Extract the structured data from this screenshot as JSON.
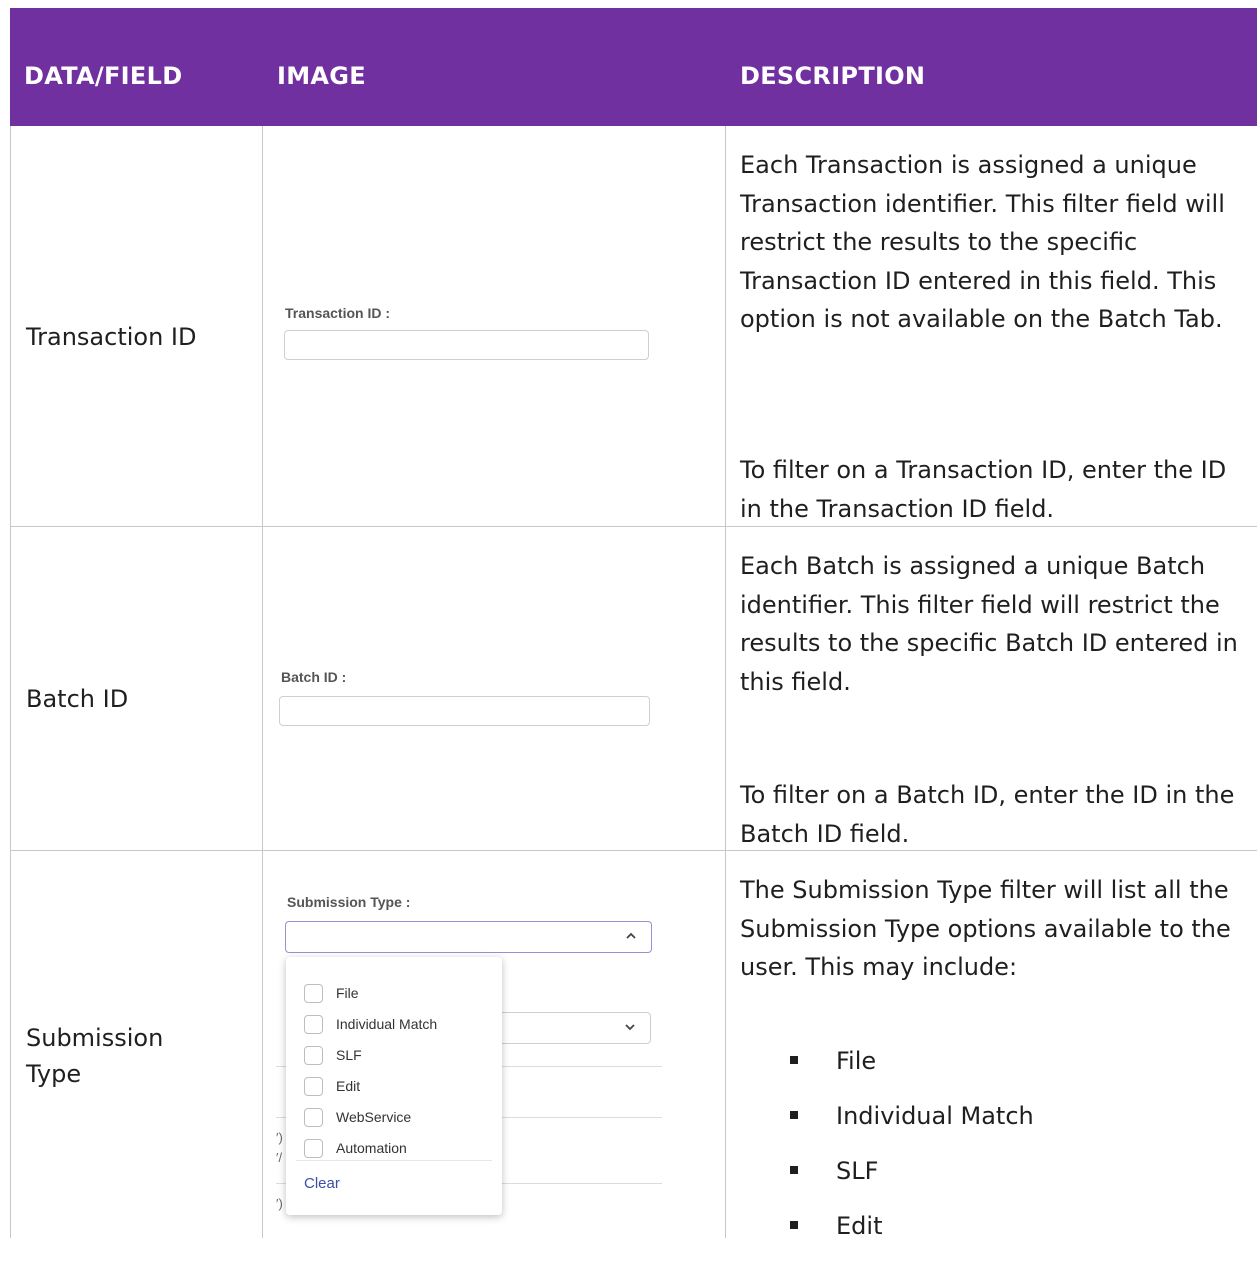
{
  "table": {
    "headers": [
      "DATA/FIELD",
      "IMAGE",
      "DESCRIPTION"
    ],
    "rows": [
      {
        "field": "Transaction ID",
        "image": {
          "label": "Transaction ID :",
          "value": ""
        },
        "description": [
          "Each Transaction is assigned a unique Transaction identifier. This filter field will restrict the results to the specific Transaction ID entered in this field. This option is not available on the Batch Tab.",
          "To filter on a Transaction ID, enter the ID in the Transaction ID field."
        ]
      },
      {
        "field": "Batch ID",
        "image": {
          "label": "Batch ID :",
          "value": ""
        },
        "description": [
          "Each Batch is assigned a unique Batch identifier. This filter field will restrict the results to the specific Batch ID entered in this field.",
          "To filter on a Batch ID, enter the ID in the Batch ID field."
        ]
      },
      {
        "field_lines": [
          "Submission",
          "Type"
        ],
        "image": {
          "label": "Submission Type :",
          "value": "",
          "options": [
            "File",
            "Individual Match",
            "SLF",
            "Edit",
            "WebService",
            "Automation"
          ],
          "clear_label": "Clear"
        },
        "description": "The Submission Type filter will list all the Submission Type options available to the user. This may include:",
        "bullets": [
          "File",
          "Individual Match",
          "SLF",
          "Edit"
        ]
      }
    ]
  },
  "colors": {
    "header_bg": "#7030a0",
    "header_text": "#ffffff",
    "grid": "#c8c8c8"
  }
}
